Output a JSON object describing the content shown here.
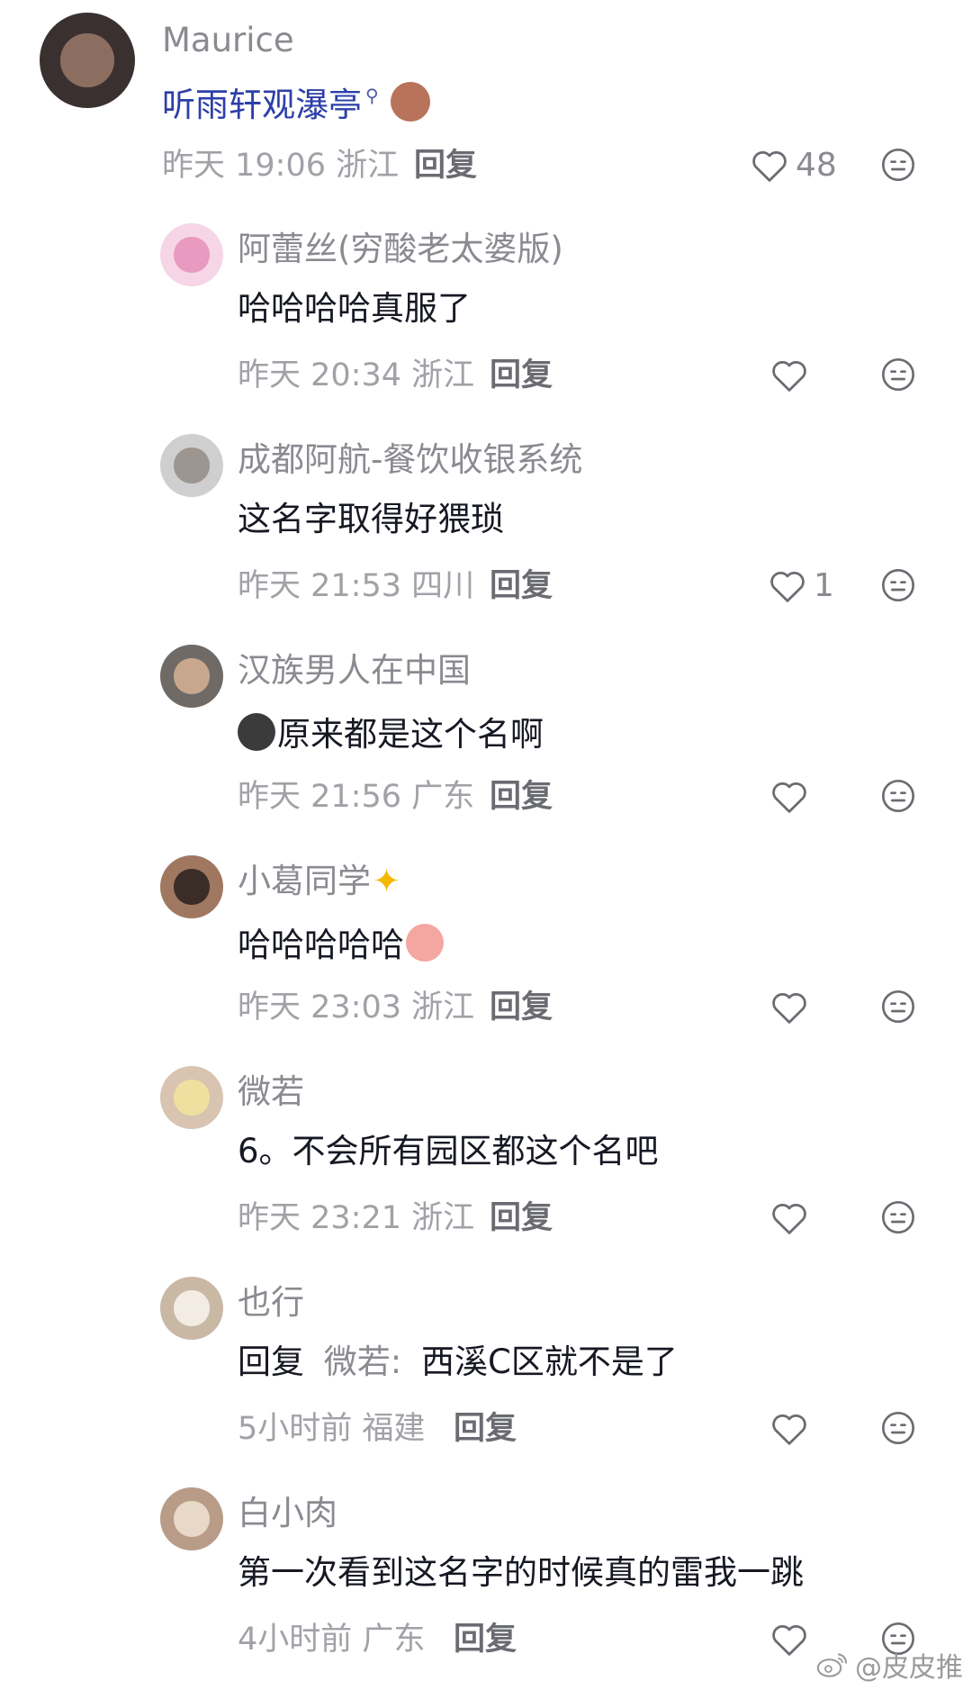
{
  "comments": [
    {
      "username": "Maurice",
      "content": "听雨轩观瀑亭",
      "time": "昨天 19:06",
      "location": "浙江",
      "reply_label": "回复",
      "likes": "48",
      "avatar_color": "#3a3030"
    },
    {
      "username": "阿蕾丝(穷酸老太婆版)",
      "content": "哈哈哈哈真服了",
      "time": "昨天 20:34",
      "location": "浙江",
      "reply_label": "回复",
      "likes": "",
      "avatar_color": "#f6d6e6"
    },
    {
      "username": "成都阿航-餐饮收银系统",
      "content": "这名字取得好猥琐",
      "time": "昨天 21:53",
      "location": "四川",
      "reply_label": "回复",
      "likes": "1",
      "avatar_color": "#cfcfcf"
    },
    {
      "username": "汉族男人在中国",
      "content": "原来都是这个名啊",
      "time": "昨天 21:56",
      "location": "广东",
      "reply_label": "回复",
      "likes": "",
      "avatar_color": "#6f6a66"
    },
    {
      "username": "小葛同学",
      "content": "哈哈哈哈哈",
      "time": "昨天 23:03",
      "location": "浙江",
      "reply_label": "回复",
      "likes": "",
      "avatar_color": "#a07860"
    },
    {
      "username": "微若",
      "content": "6。不会所有园区都这个名吧",
      "time": "昨天 23:21",
      "location": "浙江",
      "reply_label": "回复",
      "likes": "",
      "avatar_color": "#d8c4b0"
    },
    {
      "username": "也行",
      "content_prefix": "回复",
      "reply_target": "微若:",
      "content": "西溪C区就不是了",
      "time": "5小时前",
      "location": "福建",
      "reply_label": "回复",
      "likes": "",
      "avatar_color": "#c9b8a4"
    },
    {
      "username": "白小肉",
      "content": "第一次看到这名字的时候真的雷我一跳",
      "time": "4小时前",
      "location": "广东",
      "reply_label": "回复",
      "likes": "",
      "avatar_color": "#b89c88"
    }
  ],
  "watermark": {
    "text": "@皮皮推"
  },
  "icons": {
    "like": "heart-outline-icon",
    "dislike": "neutral-face-icon",
    "weibo": "weibo-logo-icon"
  }
}
